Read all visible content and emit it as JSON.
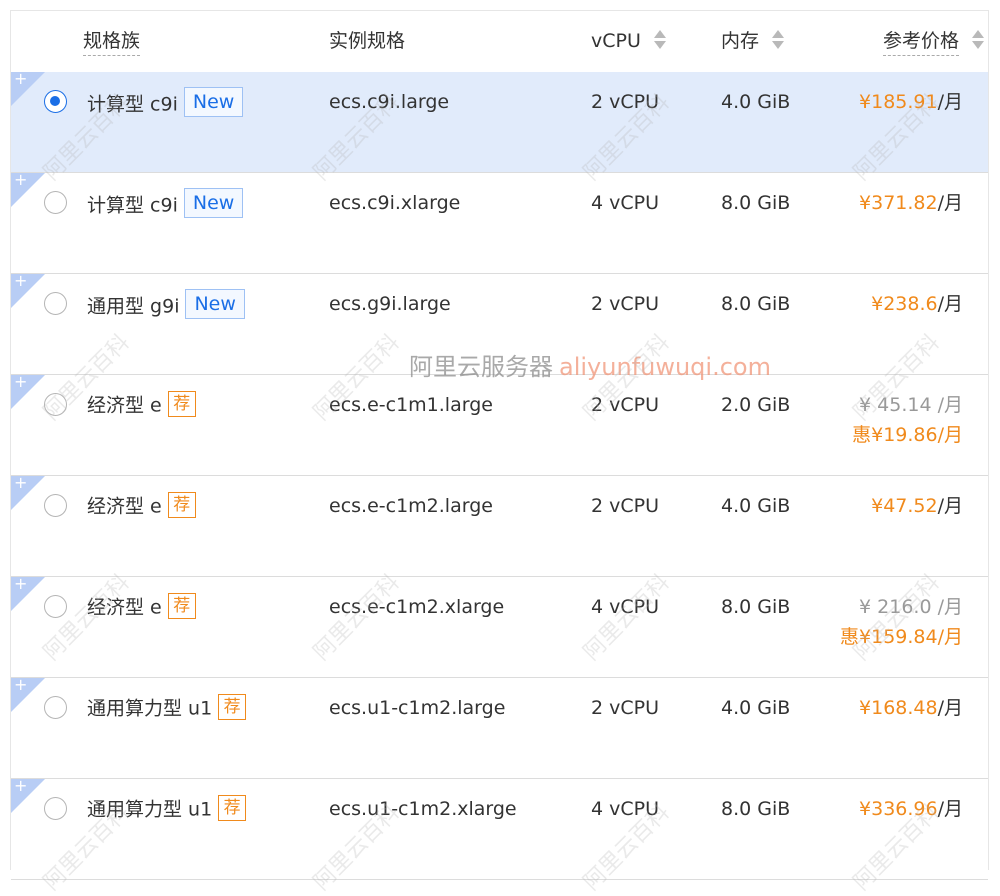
{
  "header": {
    "family": "规格族",
    "spec": "实例规格",
    "vcpu": "vCPU",
    "memory": "内存",
    "price": "参考价格"
  },
  "rows": [
    {
      "family": "计算型 c9i",
      "tag": "New",
      "spec": "ecs.c9i.large",
      "vcpu": "2 vCPU",
      "memory": "4.0 GiB",
      "price": "¥185.91",
      "unit": "/月",
      "selected": true
    },
    {
      "family": "计算型 c9i",
      "tag": "New",
      "spec": "ecs.c9i.xlarge",
      "vcpu": "4 vCPU",
      "memory": "8.0 GiB",
      "price": "¥371.82",
      "unit": "/月",
      "selected": false
    },
    {
      "family": "通用型 g9i",
      "tag": "New",
      "spec": "ecs.g9i.large",
      "vcpu": "2 vCPU",
      "memory": "8.0 GiB",
      "price": "¥238.6",
      "unit": "/月",
      "selected": false
    },
    {
      "family": "经济型 e",
      "tag": "荐",
      "spec": "ecs.e-c1m1.large",
      "vcpu": "2 vCPU",
      "memory": "2.0 GiB",
      "price_original": "¥ 45.14 /月",
      "discount_prefix": "惠",
      "price": "¥19.86",
      "unit": "/月",
      "selected": false
    },
    {
      "family": "经济型 e",
      "tag": "荐",
      "spec": "ecs.e-c1m2.large",
      "vcpu": "2 vCPU",
      "memory": "4.0 GiB",
      "price": "¥47.52",
      "unit": "/月",
      "selected": false
    },
    {
      "family": "经济型 e",
      "tag": "荐",
      "spec": "ecs.e-c1m2.xlarge",
      "vcpu": "4 vCPU",
      "memory": "8.0 GiB",
      "price_original": "¥ 216.0 /月",
      "discount_prefix": "惠",
      "price": "¥159.84",
      "unit": "/月",
      "selected": false
    },
    {
      "family": "通用算力型 u1",
      "tag": "荐",
      "spec": "ecs.u1-c1m2.large",
      "vcpu": "2 vCPU",
      "memory": "4.0 GiB",
      "price": "¥168.48",
      "unit": "/月",
      "selected": false
    },
    {
      "family": "通用算力型 u1",
      "tag": "荐",
      "spec": "ecs.u1-c1m2.xlarge",
      "vcpu": "4 vCPU",
      "memory": "8.0 GiB",
      "price": "¥336.96",
      "unit": "/月",
      "selected": false
    }
  ],
  "watermark": {
    "text": "阿里云百科",
    "center_cn": "阿里云服务器",
    "center_en": "aliyunfuwuqi.com"
  },
  "colors": {
    "accent": "#1a6ee6",
    "price": "#f08a1c",
    "selected_row": "#e1ebfb"
  },
  "icons": {
    "row_corner": "plus-icon",
    "sort": "sort-icon"
  }
}
